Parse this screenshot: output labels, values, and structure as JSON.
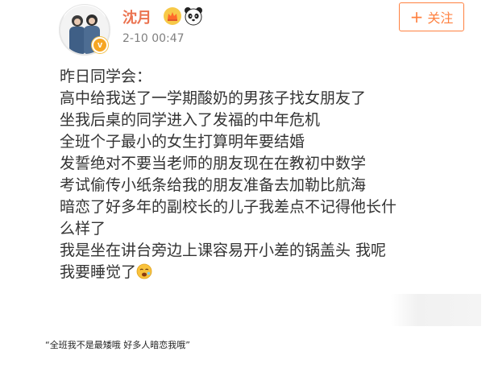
{
  "post": {
    "author_name": "沈月",
    "timestamp": "2-10 00:47",
    "follow_label": "关注",
    "follow_icon": "plus-icon",
    "verified_icon": "v-verified-icon",
    "badges": [
      "crown-badge-icon",
      "panda-icon"
    ],
    "lines": [
      "昨日同学会：",
      "高中给我送了一学期酸奶的男孩子找女朋友了",
      "坐我后桌的同学进入了发福的中年危机",
      "全班个子最小的女生打算明年要结婚",
      "发誓绝对不要当老师的朋友现在在教初中数学",
      "考试偷传小纸条给我的朋友准备去加勒比航海",
      "暗恋了好多年的副校长的儿子我差点不记得他长什",
      "么样了",
      "我是坐在讲台旁边上课容易开小差的锅盖头 我呢",
      "我要睡觉了"
    ],
    "trailing_emoji": "sleepy-face-icon"
  },
  "caption": "“全班我不是最矮哦 好多人暗恋我哦”",
  "colors": {
    "name": "#eb7350",
    "follow": "#ff8140",
    "text": "#333333",
    "time": "#808080"
  }
}
